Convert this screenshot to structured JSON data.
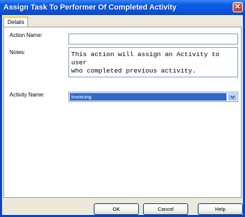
{
  "window": {
    "title": "Assign Task To Performer Of Completed Activity",
    "close_glyph": "✕"
  },
  "tabs": [
    {
      "label": "Details",
      "selected": true
    }
  ],
  "form": {
    "action_name": {
      "label": "Action Name:",
      "value": ""
    },
    "notes": {
      "label": "Notes:",
      "value": "This action will assign an Activity to user\nwho completed previous activity."
    },
    "activity_name": {
      "label": "Activity Name:",
      "selected": "Invoicing"
    }
  },
  "buttons": {
    "ok": "OK",
    "cancel": "Cancel",
    "help": "Help"
  },
  "colors": {
    "titlebar": "#0b55dc",
    "selection": "#316ac5",
    "dialog_bg": "#ece9d8"
  },
  "icons": {
    "close": "close-icon",
    "dropdown": "chevron-down-icon"
  }
}
